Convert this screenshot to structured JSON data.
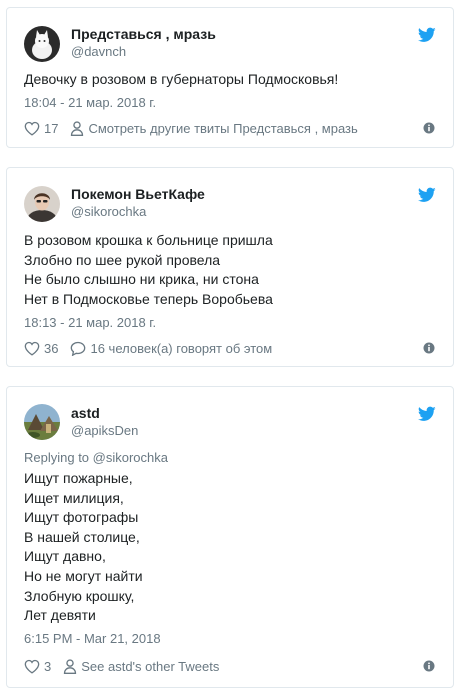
{
  "tweets": [
    {
      "name": "Представься , мразь",
      "handle": "@davnch",
      "reply_to": "",
      "lines": [
        "Девочку в розовом в губернаторы Подмосковья!"
      ],
      "time": "18:04 - 21 мар. 2018 г.",
      "likes": "17",
      "secondary_action": "Смотреть другие твиты Представься , мразь",
      "secondary_icon": "person-icon",
      "avatar": "cat-avatar"
    },
    {
      "name": "Покемон ВьетКафе",
      "handle": "@sikorochka",
      "reply_to": "",
      "lines": [
        "В розовом крошка к больнице пришла",
        "Злобно по шее рукой провела",
        "Не было слышно ни крика, ни стона",
        "Нет в Подмосковье теперь Воробьева"
      ],
      "time": "18:13 - 21 мар. 2018 г.",
      "likes": "36",
      "secondary_action": "16 человек(а) говорят об этом",
      "secondary_icon": "speech-bubble-icon",
      "avatar": "person-avatar"
    },
    {
      "name": "astd",
      "handle": "@apiksDen",
      "reply_to": "Replying to @sikorochka",
      "lines": [
        "Ищут пожарные,",
        "Ищет милиция,",
        "Ищут фотографы",
        "В нашей столице,",
        "Ищут давно,",
        "Но не могут найти",
        "Злобную крошку,",
        "Лет девяти"
      ],
      "time": "6:15 PM - Mar 21, 2018",
      "likes": "3",
      "secondary_action": "See astd's other Tweets",
      "secondary_icon": "person-icon",
      "avatar": "landscape-avatar"
    }
  ],
  "colors": {
    "twitter_blue": "#1da1f2",
    "meta_gray": "#697882",
    "text": "#1c2022",
    "border": "#e1e8ed"
  }
}
